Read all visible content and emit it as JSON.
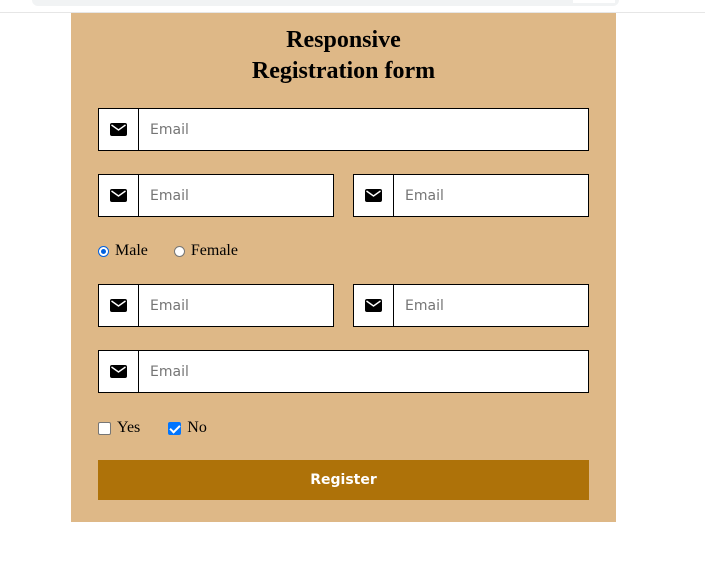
{
  "form": {
    "title_line1": "Responsive",
    "title_line2": "Registration form",
    "icon": "envelope-icon",
    "fields": [
      {
        "placeholder": "Email",
        "value": ""
      },
      {
        "placeholder": "Email",
        "value": ""
      },
      {
        "placeholder": "Email",
        "value": ""
      },
      {
        "placeholder": "Email",
        "value": ""
      },
      {
        "placeholder": "Email",
        "value": ""
      },
      {
        "placeholder": "Email",
        "value": ""
      }
    ],
    "gender": {
      "options": [
        "Male",
        "Female"
      ],
      "selected": "Male"
    },
    "checkboxes": [
      {
        "label": "Yes",
        "checked": false
      },
      {
        "label": "No",
        "checked": true
      }
    ],
    "register_label": "Register"
  },
  "colors": {
    "card_background": "#deb887",
    "button_background": "#ae7209",
    "radio_accent": "#0060df",
    "checkbox_accent": "#0075ff"
  }
}
